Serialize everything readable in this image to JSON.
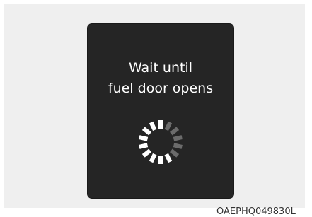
{
  "dialog": {
    "message_line1": "Wait until",
    "message_line2": "fuel door opens",
    "spinner_icon": "loading-spinner-icon"
  },
  "figure": {
    "code": "OAEPHQ049830L"
  },
  "colors": {
    "background": "#efefef",
    "screen": "#252525",
    "text": "#ffffff",
    "spinner_active": "#ffffff",
    "spinner_inactive": "#6b6b6b"
  }
}
